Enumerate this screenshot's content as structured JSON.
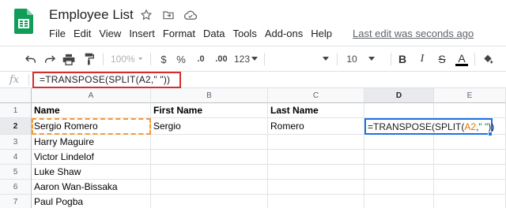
{
  "doc": {
    "title": "Employee List",
    "last_edit": "Last edit was seconds ago"
  },
  "menu": [
    "File",
    "Edit",
    "View",
    "Insert",
    "Format",
    "Data",
    "Tools",
    "Add-ons",
    "Help"
  ],
  "toolbar": {
    "zoom": "100%",
    "currency": "$",
    "percent": "%",
    "dec_decrease": ".0",
    "dec_increase": ".00",
    "more_formats": "123",
    "font_size": "10",
    "bold": "B",
    "italic": "I",
    "strike": "S",
    "text_color": "A"
  },
  "formula_bar": {
    "fx_label": "fx",
    "formula": "=TRANSPOSE(SPLIT(A2,\" \"))"
  },
  "grid": {
    "columns": [
      "A",
      "B",
      "C",
      "D",
      "E"
    ],
    "rows": [
      "1",
      "2",
      "3",
      "4",
      "5",
      "6",
      "7"
    ],
    "headers": [
      "Name",
      "First Name",
      "Last Name"
    ],
    "names": [
      "Sergio Romero",
      "Harry Maguire",
      "Victor Lindelof",
      "Luke Shaw",
      "Aaron Wan-Bissaka",
      "Paul Pogba"
    ],
    "row2": {
      "first": "Sergio",
      "last": "Romero"
    },
    "active_cell": {
      "prefix": "=TRANSPOSE(SPLIT(",
      "ref": "A2",
      "comma": ",",
      "str": "\" \"",
      "suffix": "))"
    }
  },
  "colors": {
    "accent": "#1a73e8",
    "highlight_box": "#d32f2f",
    "copy_border": "#f29b38",
    "sheets_green": "#0f9d58"
  }
}
